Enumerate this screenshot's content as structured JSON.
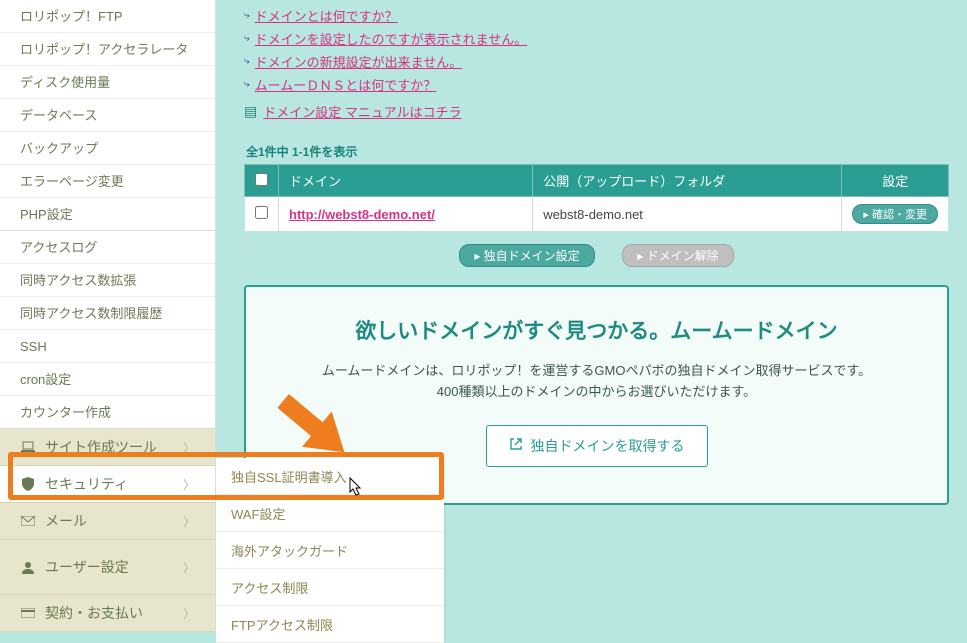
{
  "sidebar": {
    "items": [
      "ロリポップ！FTP",
      "ロリポップ！アクセラレータ",
      "ディスク使用量",
      "データベース",
      "バックアップ",
      "エラーページ変更",
      "PHP設定",
      "アクセスログ",
      "同時アクセス数拡張",
      "同時アクセス数制限履歴",
      "SSH",
      "cron設定",
      "カウンター作成"
    ],
    "cats": {
      "site": "サイト作成ツール",
      "security": "セキュリティ",
      "mail": "メール",
      "user": "ユーザー設定",
      "billing": "契約・お支払い"
    }
  },
  "submenu": {
    "ssl": "独自SSL証明書導入",
    "waf": "WAF設定",
    "attack": "海外アタックガード",
    "access": "アクセス制限",
    "ftp": "FTPアクセス制限"
  },
  "faq": {
    "q1": "ドメインとは何ですか？",
    "q2": "ドメインを設定したのですが表示されません。",
    "q3": "ドメインの新規設定が出来ません。",
    "q4": "ムームーＤＮＳとは何ですか？",
    "manual": "ドメイン設定 マニュアルはコチラ"
  },
  "table": {
    "count": "全1件中 1-1件を表示",
    "h_domain": "ドメイン",
    "h_folder": "公開（アップロード）フォルダ",
    "h_set": "設定",
    "row1_domain": "http://webst8-demo.net/",
    "row1_folder": "webst8-demo.net",
    "confirm": "▸ 確認・変更"
  },
  "btns": {
    "own": "▸ 独自ドメイン設定",
    "release": "▸ ドメイン解除"
  },
  "promo": {
    "title": "欲しいドメインがすぐ見つかる。ムームードメイン",
    "p1": "ムームードメインは、ロリポップ！を運営するGMOペパボの独自ドメイン取得サービスです。",
    "p2": "400種類以上のドメインの中からお選びいただけます。",
    "cta": "独自ドメインを取得する"
  }
}
